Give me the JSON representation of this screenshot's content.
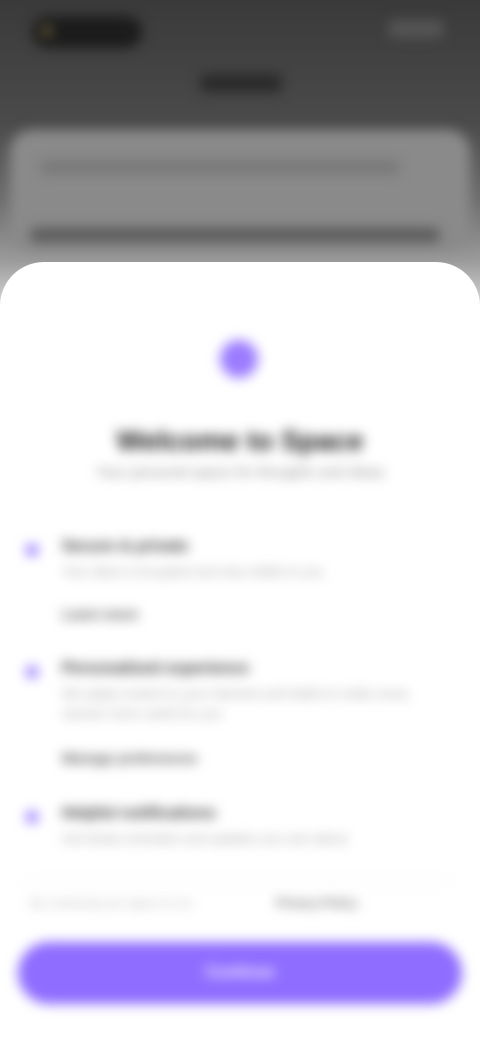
{
  "modal": {
    "title": "Welcome to Space",
    "subtitle": "Your personal space for thoughts and ideas",
    "features": [
      {
        "title": "Secure & private",
        "description": "Your data is encrypted and only visible to you.",
        "link": "Learn more"
      },
      {
        "title": "Personalized experience",
        "description": "We adapt content to your interests and habits to make every session more useful for you.",
        "link": "Manage preferences"
      },
      {
        "title": "Helpful notifications",
        "description": "Get timely reminders and updates you care about."
      }
    ],
    "consent": {
      "text": "By continuing you agree to our",
      "link": "Privacy Policy"
    },
    "primary_button": "Continue"
  },
  "colors": {
    "accent": "#8f6dff",
    "sheet_background": "#ffffff"
  },
  "icons": {
    "logo": "sparkle-dot-icon",
    "bullet": "bullet-dot-icon"
  }
}
